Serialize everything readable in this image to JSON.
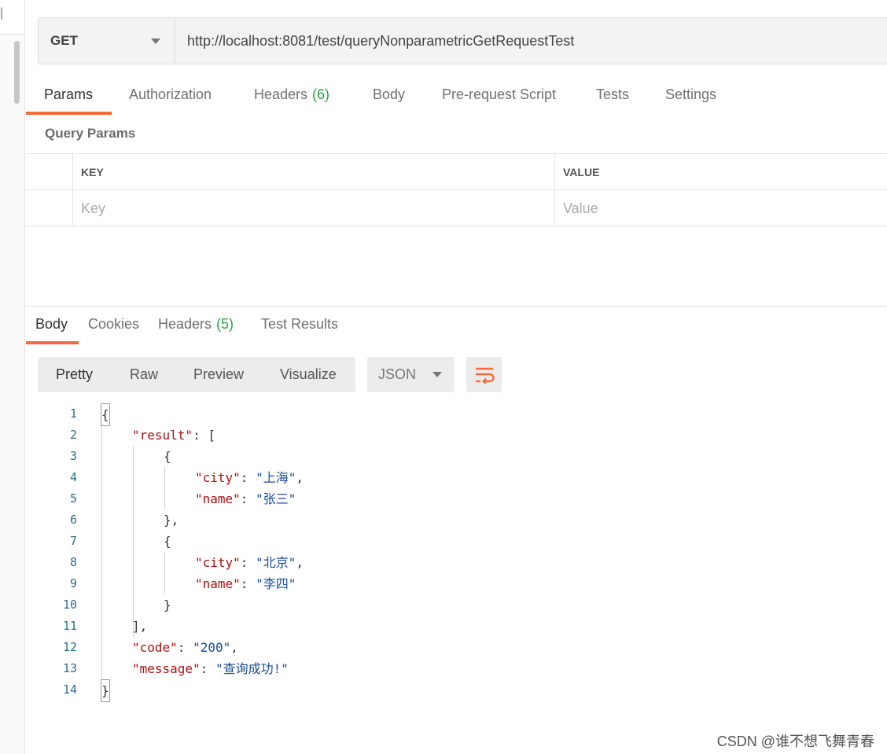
{
  "request": {
    "method": "GET",
    "url": "http://localhost:8081/test/queryNonparametricGetRequestTest"
  },
  "request_tabs": [
    {
      "label": "Params",
      "count": ""
    },
    {
      "label": "Authorization",
      "count": ""
    },
    {
      "label": "Headers",
      "count": "(6)"
    },
    {
      "label": "Body",
      "count": ""
    },
    {
      "label": "Pre-request Script",
      "count": ""
    },
    {
      "label": "Tests",
      "count": ""
    },
    {
      "label": "Settings",
      "count": ""
    }
  ],
  "params": {
    "title": "Query Params",
    "headers": {
      "key": "KEY",
      "value": "VALUE"
    },
    "placeholders": {
      "key": "Key",
      "value": "Value"
    }
  },
  "response_tabs": [
    {
      "label": "Body",
      "count": ""
    },
    {
      "label": "Cookies",
      "count": ""
    },
    {
      "label": "Headers",
      "count": "(5)"
    },
    {
      "label": "Test Results",
      "count": ""
    }
  ],
  "view_modes": [
    "Pretty",
    "Raw",
    "Preview",
    "Visualize"
  ],
  "format": "JSON",
  "colors": {
    "accent": "#f26b3a",
    "count_green": "#2e9e49"
  },
  "icons": {
    "wrap": "wrap-lines-icon",
    "dropdown": "chevron-down-icon"
  },
  "code": {
    "line_numbers": [
      "1",
      "2",
      "3",
      "4",
      "5",
      "6",
      "7",
      "8",
      "9",
      "10",
      "11",
      "12",
      "13",
      "14"
    ],
    "tokens": {
      "l1": "{",
      "l2_key": "\"result\"",
      "l2_rest": ": [",
      "l3": "{",
      "l4_key": "\"city\"",
      "l4_sep": ": ",
      "l4_val": "\"上海\"",
      "l4_end": ",",
      "l5_key": "\"name\"",
      "l5_sep": ": ",
      "l5_val": "\"张三\"",
      "l6": "},",
      "l7": "{",
      "l8_key": "\"city\"",
      "l8_sep": ": ",
      "l8_val": "\"北京\"",
      "l8_end": ",",
      "l9_key": "\"name\"",
      "l9_sep": ": ",
      "l9_val": "\"李四\"",
      "l10": "}",
      "l11": "],",
      "l12_key": "\"code\"",
      "l12_sep": ": ",
      "l12_val": "\"200\"",
      "l12_end": ",",
      "l13_key": "\"message\"",
      "l13_sep": ": ",
      "l13_val": "\"查询成功!\"",
      "l14": "}"
    }
  },
  "watermark": "CSDN @谁不想飞舞青春"
}
